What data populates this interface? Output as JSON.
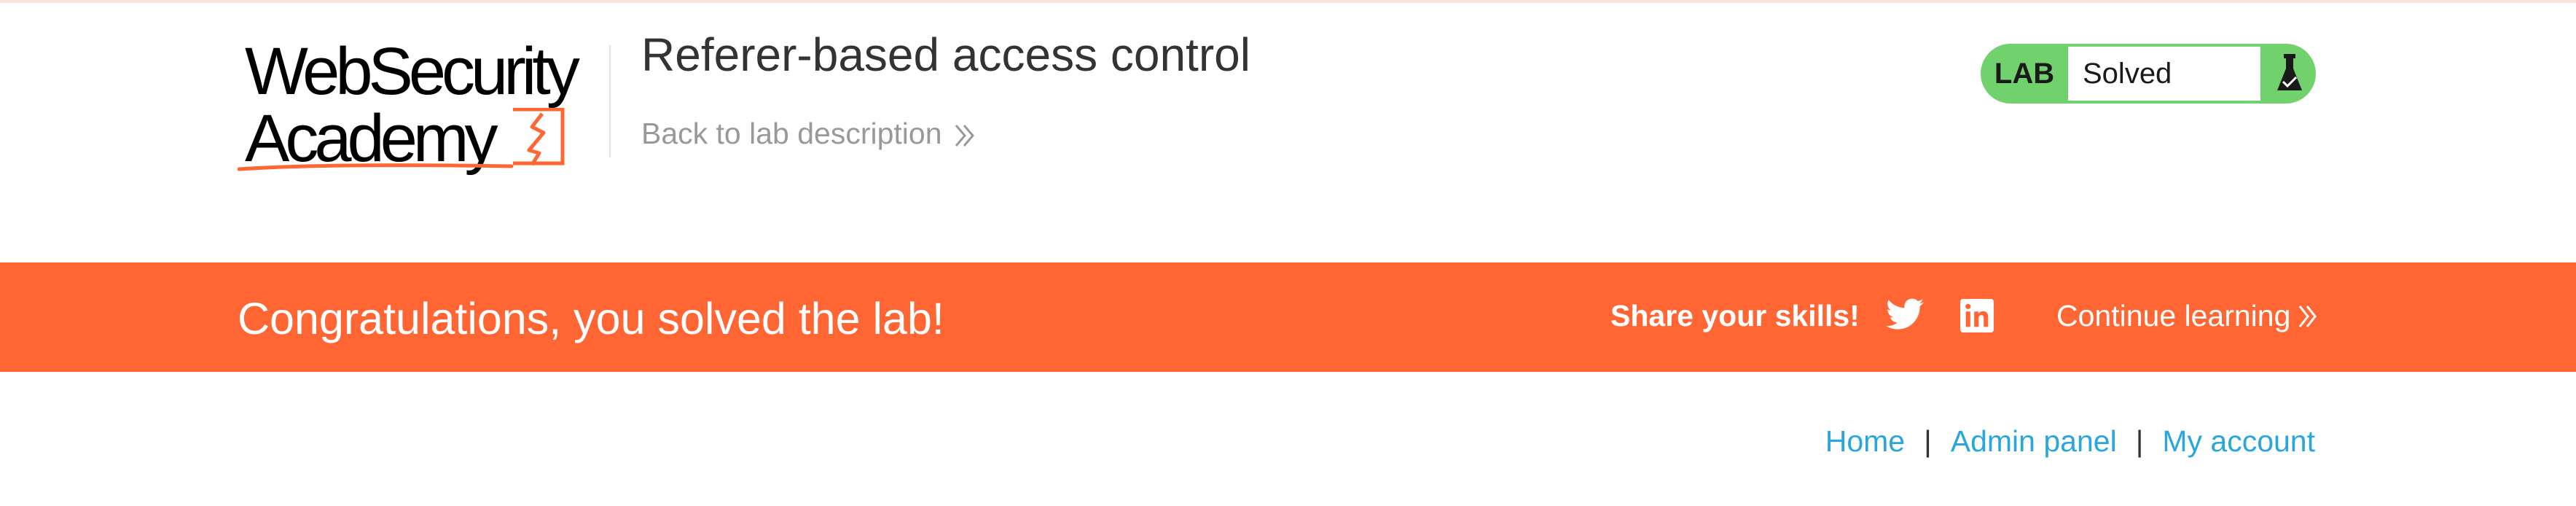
{
  "header": {
    "logo_line1": "WebSecurity",
    "logo_line2": "Academy",
    "lab_title": "Referer-based access control",
    "back_link": "Back to lab description"
  },
  "lab_status": {
    "label": "LAB",
    "value": "Solved",
    "icon": "flask-check-icon",
    "accent": "#70d16d"
  },
  "banner": {
    "message": "Congratulations, you solved the lab!",
    "share_label": "Share your skills!",
    "continue_label": "Continue learning",
    "icons": [
      "twitter-icon",
      "linkedin-icon"
    ],
    "background": "#ff6633"
  },
  "nav": {
    "home": "Home",
    "separator": "|",
    "admin_panel": "Admin panel",
    "my_account": "My account",
    "link_color": "#29a6dd"
  }
}
